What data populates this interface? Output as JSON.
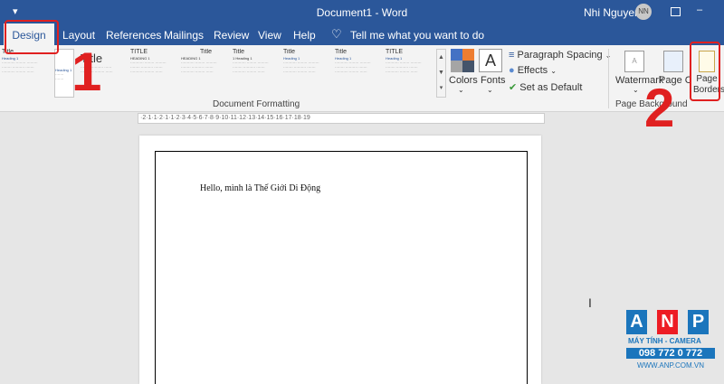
{
  "app": {
    "title": "Document1 - Word",
    "user": "Nhi Nguyen",
    "initials": "NN",
    "qa_icon": "customize-quick-access-icon",
    "restore_icon": "ribbon-display-icon",
    "minimize": "–",
    "maximize": "□"
  },
  "tabs": [
    {
      "label": "Design"
    },
    {
      "label": "Layout"
    },
    {
      "label": "References"
    },
    {
      "label": "Mailings"
    },
    {
      "label": "Review"
    },
    {
      "label": "View"
    },
    {
      "label": "Help"
    }
  ],
  "tell_me": "Tell me what you want to do",
  "ribbon": {
    "style_thumbs": [
      {
        "title": "Title",
        "heading": "Heading 1"
      },
      {
        "title": "Title",
        "heading": "Heading 1"
      },
      {
        "title": "TITLE",
        "heading": "HEADING 1"
      },
      {
        "title": "Title",
        "heading": "HEADING 1"
      },
      {
        "title": "Title",
        "heading": "1  Heading 1"
      },
      {
        "title": "Title",
        "heading": "Heading 1"
      },
      {
        "title": "Title",
        "heading": "Heading 1"
      },
      {
        "title": "TITLE",
        "heading": "Heading 1"
      }
    ],
    "colors_label": "Colors",
    "fonts_label": "Fonts",
    "fonts_glyph": "A",
    "paragraph_spacing_label": "Paragraph Spacing",
    "effects_label": "Effects",
    "set_default_label": "Set as Default",
    "document_formatting_label": "Document Formatting",
    "watermark_label": "Watermark",
    "page_color_label": "Page Color",
    "page_borders_label_1": "Page",
    "page_borders_label_2": "Borders",
    "page_background_label": "Page Background"
  },
  "ruler": "·2·1·1·2·1·1·2·3·4·5·6·7·8·9·10·11·12·13·14·15·16·17·18·19",
  "document": {
    "text": "Hello, mình là Thế Giới Di Động"
  },
  "annotations": {
    "step1": "1",
    "step2": "2"
  },
  "logo": {
    "letters": [
      "A",
      "N",
      "P"
    ],
    "line1": "MÁY TÍNH - CAMERA",
    "phone": "098 772 0 772",
    "website": "WWW.ANP.COM.VN"
  },
  "colors": {
    "brand": "#2b579a",
    "annotation": "#e02020",
    "logo_blue": "#1b75bc",
    "logo_red": "#ed1c24"
  }
}
